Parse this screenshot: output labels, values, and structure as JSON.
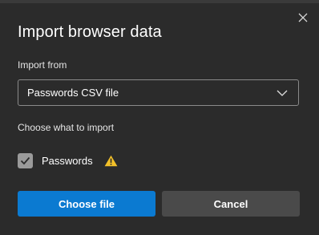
{
  "dialog": {
    "title": "Import browser data",
    "close_icon": "close-icon"
  },
  "import_from": {
    "label": "Import from",
    "selected": "Passwords CSV file",
    "chevron_icon": "chevron-down-icon"
  },
  "choose": {
    "label": "Choose what to import",
    "items": [
      {
        "label": "Passwords",
        "checked": true,
        "warning_icon": "warning-icon"
      }
    ]
  },
  "buttons": {
    "primary": "Choose file",
    "secondary": "Cancel"
  },
  "colors": {
    "accent": "#0b7ad1",
    "warning": "#f2c029",
    "dialog_bg": "#2b2b2b"
  }
}
